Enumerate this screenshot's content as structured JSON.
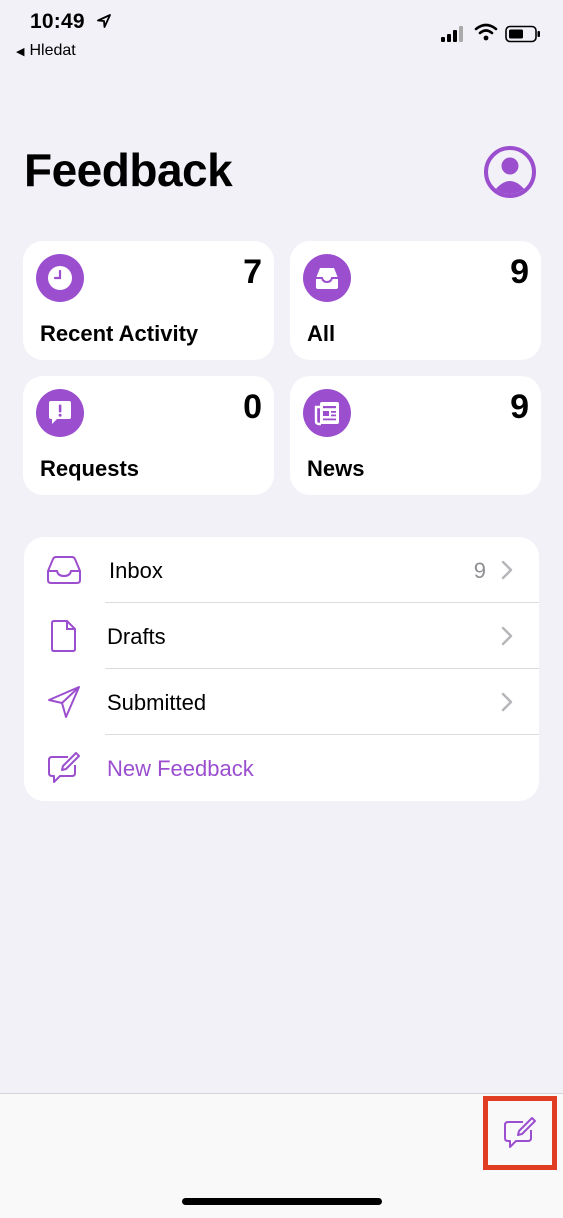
{
  "status_bar": {
    "time": "10:49",
    "back_app": "Hledat"
  },
  "header": {
    "title": "Feedback"
  },
  "tiles": [
    {
      "label": "Recent Activity",
      "count": "7",
      "icon": "clock-icon"
    },
    {
      "label": "All",
      "count": "9",
      "icon": "tray-icon"
    },
    {
      "label": "Requests",
      "count": "0",
      "icon": "exclamation-bubble-icon"
    },
    {
      "label": "News",
      "count": "9",
      "icon": "newspaper-icon"
    }
  ],
  "list": {
    "items": [
      {
        "label": "Inbox",
        "count": "9",
        "icon": "tray-icon"
      },
      {
        "label": "Drafts",
        "icon": "document-icon"
      },
      {
        "label": "Submitted",
        "icon": "paper-plane-icon"
      },
      {
        "label": "New Feedback",
        "icon": "compose-bubble-icon"
      }
    ]
  },
  "colors": {
    "accent": "#9b4fcf",
    "background": "#f2f1f7",
    "highlight_border": "#e03d23"
  }
}
